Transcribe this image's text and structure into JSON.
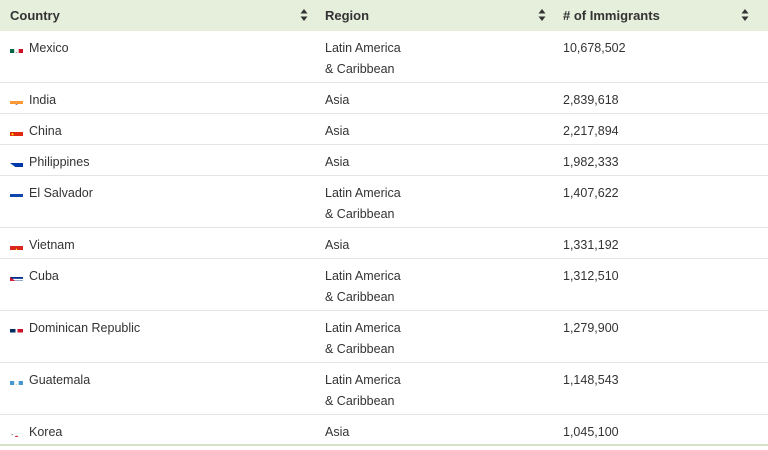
{
  "headers": {
    "country": "Country",
    "region": "Region",
    "immigrants": "# of Immigrants"
  },
  "rows": [
    {
      "country": "Mexico",
      "flag": "mexico-flag-icon",
      "region": "Latin America\n& Caribbean",
      "count": "10,678,502"
    },
    {
      "country": "India",
      "flag": "india-flag-icon",
      "region": "Asia",
      "count": "2,839,618"
    },
    {
      "country": "China",
      "flag": "china-flag-icon",
      "region": "Asia",
      "count": "2,217,894"
    },
    {
      "country": "Philippines",
      "flag": "philippines-flag-icon",
      "region": "Asia",
      "count": "1,982,333"
    },
    {
      "country": "El Salvador",
      "flag": "el-salvador-flag-icon",
      "region": "Latin America\n& Caribbean",
      "count": "1,407,622"
    },
    {
      "country": "Vietnam",
      "flag": "vietnam-flag-icon",
      "region": "Asia",
      "count": "1,331,192"
    },
    {
      "country": "Cuba",
      "flag": "cuba-flag-icon",
      "region": "Latin America\n& Caribbean",
      "count": "1,312,510"
    },
    {
      "country": "Dominican Republic",
      "flag": "dominican-republic-flag-icon",
      "region": "Latin America\n& Caribbean",
      "count": "1,279,900"
    },
    {
      "country": "Guatemala",
      "flag": "guatemala-flag-icon",
      "region": "Latin America\n& Caribbean",
      "count": "1,148,543"
    },
    {
      "country": "Korea",
      "flag": "korea-flag-icon",
      "region": "Asia",
      "count": "1,045,100"
    }
  ],
  "colors": {
    "header_bg": "#e6eedc",
    "row_border": "#e4e4e4",
    "text": "#333333"
  }
}
